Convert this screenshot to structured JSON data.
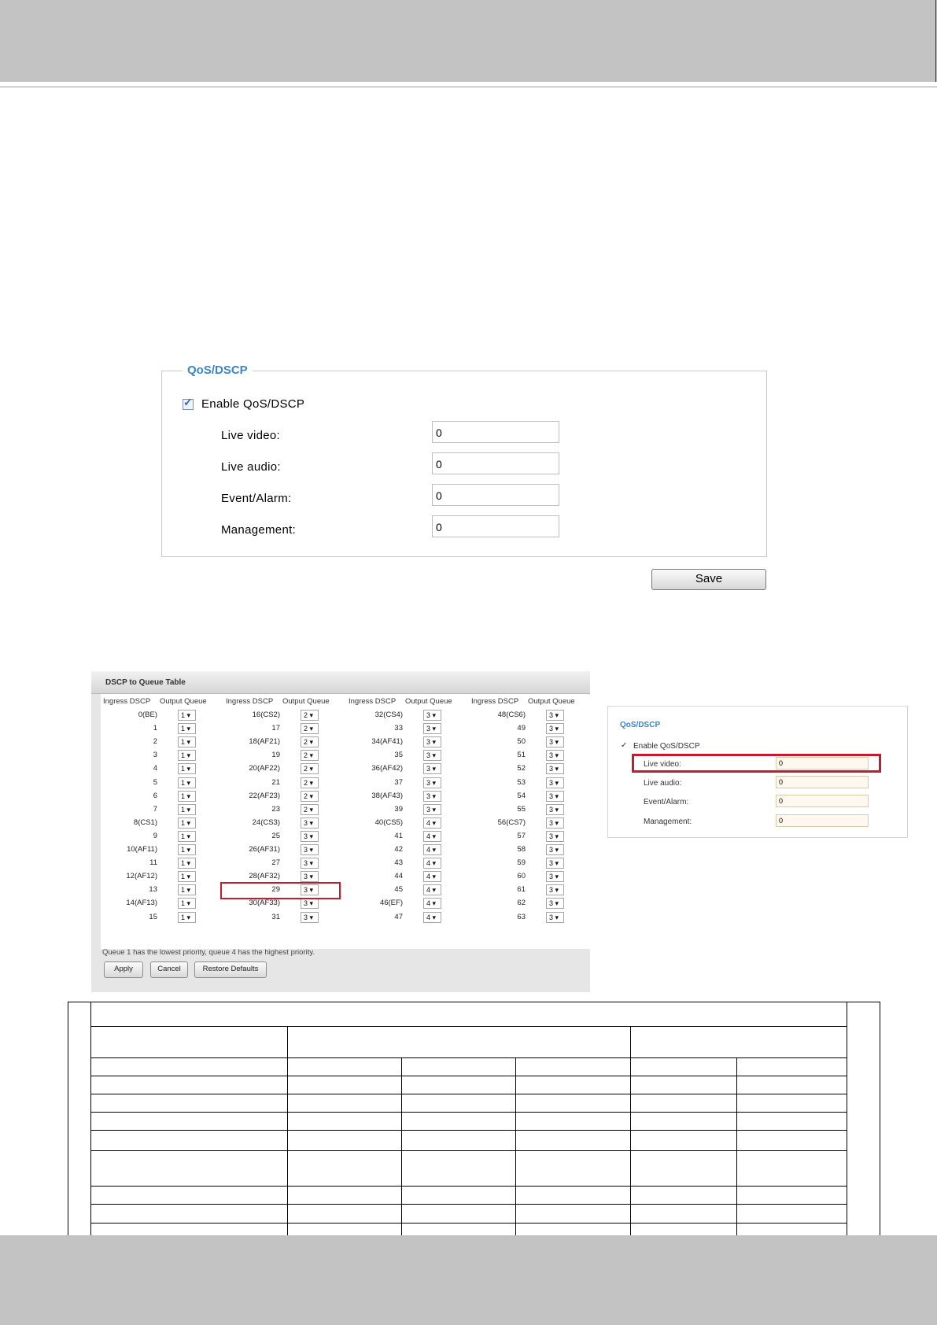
{
  "qos_panel": {
    "legend": "QoS/DSCP",
    "enable_label": "Enable QoS/DSCP",
    "enabled": true,
    "fields": [
      {
        "label": "Live video:",
        "value": "0"
      },
      {
        "label": "Live audio:",
        "value": "0"
      },
      {
        "label": "Event/Alarm:",
        "value": "0"
      },
      {
        "label": "Management:",
        "value": "0"
      }
    ],
    "save_label": "Save"
  },
  "dscp_table": {
    "title": "DSCP to Queue Table",
    "headers": [
      "Ingress DSCP",
      "Output Queue",
      "Ingress DSCP",
      "Output Queue",
      "Ingress DSCP",
      "Output Queue",
      "Ingress DSCP",
      "Output Queue"
    ],
    "columns": [
      {
        "ingress": [
          "0(BE)",
          "1",
          "2",
          "3",
          "4",
          "5",
          "6",
          "7",
          "8(CS1)",
          "9",
          "10(AF11)",
          "11",
          "12(AF12)",
          "13",
          "14(AF13)",
          "15"
        ],
        "queue": [
          "1 ▾",
          "1 ▾",
          "1 ▾",
          "1 ▾",
          "1 ▾",
          "1 ▾",
          "1 ▾",
          "1 ▾",
          "1 ▾",
          "1 ▾",
          "1 ▾",
          "1 ▾",
          "1 ▾",
          "1 ▾",
          "1 ▾",
          "1 ▾"
        ]
      },
      {
        "ingress": [
          "16(CS2)",
          "17",
          "18(AF21)",
          "19",
          "20(AF22)",
          "21",
          "22(AF23)",
          "23",
          "24(CS3)",
          "25",
          "26(AF31)",
          "27",
          "28(AF32)",
          "29",
          "30(AF33)",
          "31"
        ],
        "queue": [
          "2 ▾",
          "2 ▾",
          "2 ▾",
          "2 ▾",
          "2 ▾",
          "2 ▾",
          "2 ▾",
          "2 ▾",
          "3 ▾",
          "3 ▾",
          "3 ▾",
          "3 ▾",
          "3 ▾",
          "3 ▾",
          "3 ▾",
          "3 ▾"
        ]
      },
      {
        "ingress": [
          "32(CS4)",
          "33",
          "34(AF41)",
          "35",
          "36(AF42)",
          "37",
          "38(AF43)",
          "39",
          "40(CS5)",
          "41",
          "42",
          "43",
          "44",
          "45",
          "46(EF)",
          "47"
        ],
        "queue": [
          "3 ▾",
          "3 ▾",
          "3 ▾",
          "3 ▾",
          "3 ▾",
          "3 ▾",
          "3 ▾",
          "3 ▾",
          "4 ▾",
          "4 ▾",
          "4 ▾",
          "4 ▾",
          "4 ▾",
          "4 ▾",
          "4 ▾",
          "4 ▾"
        ]
      },
      {
        "ingress": [
          "48(CS6)",
          "49",
          "50",
          "51",
          "52",
          "53",
          "54",
          "55",
          "56(CS7)",
          "57",
          "58",
          "59",
          "60",
          "61",
          "62",
          "63"
        ],
        "queue": [
          "3 ▾",
          "3 ▾",
          "3 ▾",
          "3 ▾",
          "3 ▾",
          "3 ▾",
          "3 ▾",
          "3 ▾",
          "3 ▾",
          "3 ▾",
          "3 ▾",
          "3 ▾",
          "3 ▾",
          "3 ▾",
          "3 ▾",
          "3 ▾"
        ]
      }
    ],
    "note": "Queue 1 has the lowest priority, queue 4 has the highest priority.",
    "buttons": {
      "apply": "Apply",
      "cancel": "Cancel",
      "restore": "Restore Defaults"
    }
  },
  "small_panel": {
    "legend": "QoS/DSCP",
    "check_mark": "✓",
    "enable_label": "Enable QoS/DSCP",
    "fields": [
      {
        "label": "Live video:",
        "value": "0"
      },
      {
        "label": "Live audio:",
        "value": "0"
      },
      {
        "label": "Event/Alarm:",
        "value": "0"
      },
      {
        "label": "Management:",
        "value": "0"
      }
    ]
  }
}
